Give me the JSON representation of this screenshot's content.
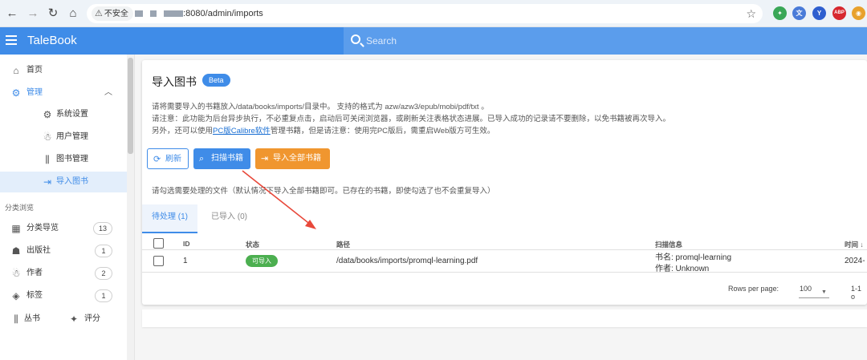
{
  "browser": {
    "security_label": "不安全",
    "url_visible": ":8080/admin/imports",
    "extensions": [
      {
        "name": "ext-green",
        "color": "#3aa757",
        "label": "✦"
      },
      {
        "name": "ext-translate",
        "color": "#4a7bd8",
        "label": "文"
      },
      {
        "name": "ext-y",
        "color": "#2f5fcf",
        "label": "Y"
      },
      {
        "name": "ext-abp",
        "color": "#d7282f",
        "label": "ABP"
      },
      {
        "name": "ext-circle",
        "color": "#e8a12c",
        "label": "◉"
      }
    ]
  },
  "header": {
    "brand": "TaleBook",
    "search_placeholder": "Search"
  },
  "sidebar": {
    "home": "首页",
    "manage": "管理",
    "sub_items": [
      "系统设置",
      "用户管理",
      "图书管理",
      "导入图书"
    ],
    "section_title": "分类浏览",
    "categories": [
      {
        "label": "分类导览",
        "count": "13"
      },
      {
        "label": "出版社",
        "count": "1"
      },
      {
        "label": "作者",
        "count": "2"
      },
      {
        "label": "标签",
        "count": "1"
      }
    ],
    "bottom_left": "丛书",
    "bottom_right": "评分"
  },
  "main": {
    "title": "导入图书",
    "beta": "Beta",
    "desc_line1": "请将需要导入的书籍放入/data/books/imports/目录中。 支持的格式为 azw/azw3/epub/mobi/pdf/txt 。",
    "desc_line2": "请注意：此功能为后台异步执行，不必重复点击，启动后可关闭浏览器，或刷新关注表格状态进展。已导入成功的记录请不要删除，以免书籍被再次导入。",
    "desc_line3_pre": "另外，还可以使用",
    "desc_line3_link": "PC版Calibre软件",
    "desc_line3_post": "管理书籍，但是请注意：使用完PC版后，需重启Web版方可生效。",
    "btn_refresh": "刷新",
    "btn_scan": "扫描书籍",
    "btn_import_all": "导入全部书籍",
    "hint": "请勾选需要处理的文件（默认情况下导入全部书籍即可。已存在的书籍，即使勾选了也不会重复导入）",
    "tabs": [
      "待处理 (1)",
      "已导入 (0)"
    ],
    "table": {
      "headers": [
        "ID",
        "状态",
        "路径",
        "扫描信息",
        "时间 ↓"
      ],
      "rows": [
        {
          "id": "1",
          "status": "可导入",
          "path": "/data/books/imports/promql-learning.pdf",
          "info_title": "书名:  promql-learning",
          "info_author": "作者:  Unknown",
          "time": "2024-"
        }
      ]
    },
    "footer": {
      "rows_per_page_label": "Rows per page:",
      "rows_per_page_value": "100",
      "range": "1-1 o"
    }
  },
  "colors": {
    "primary": "#3f8ce8",
    "orange": "#f0962f",
    "success": "#4caf50",
    "arrow": "#e8483a"
  }
}
